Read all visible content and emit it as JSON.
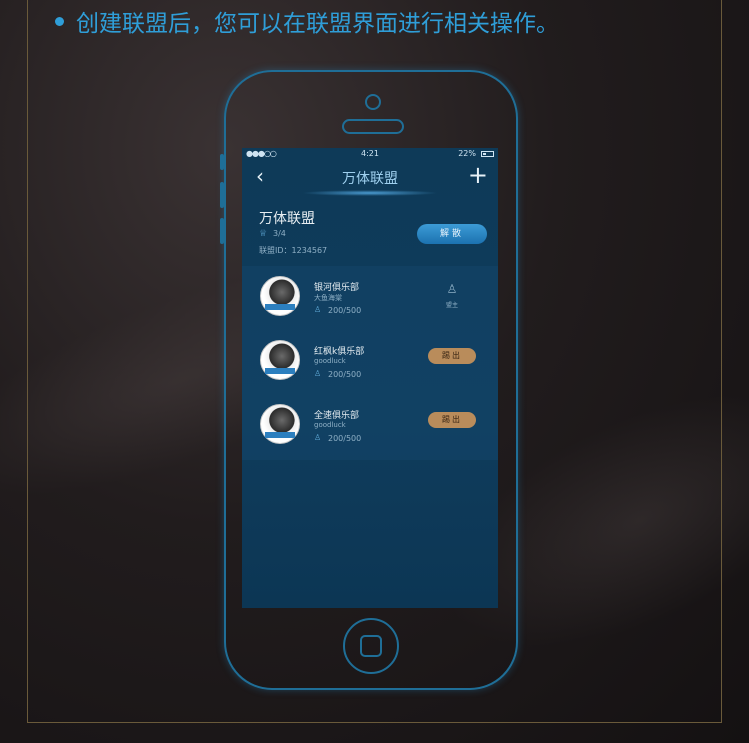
{
  "headline": "创建联盟后，您可以在联盟界面进行相关操作。",
  "status_bar": {
    "signal": "●●●○○",
    "time": "4:21",
    "battery": "22%"
  },
  "nav": {
    "back_icon": "‹",
    "title": "万体联盟",
    "add_icon": "+"
  },
  "alliance": {
    "name": "万体联盟",
    "members": "3/4",
    "id_text": "联盟ID：1234567",
    "disband_label": "解散"
  },
  "clubs": [
    {
      "name": "银河俱乐部",
      "owner": "大鱼海棠",
      "count": "200/500",
      "action": "leader",
      "leader_label": "盟主"
    },
    {
      "name": "红枫k俱乐部",
      "owner": "goodluck",
      "count": "200/500",
      "action": "kick",
      "kick_label": "踢出"
    },
    {
      "name": "全速俱乐部",
      "owner": "goodluck",
      "count": "200/500",
      "action": "kick",
      "kick_label": "踢出"
    }
  ],
  "colors": {
    "accent": "#2f9ed8",
    "kick_button": "#b98c5b",
    "disband_button": "#2a86c4",
    "phone_outline": "#1f6e97"
  }
}
